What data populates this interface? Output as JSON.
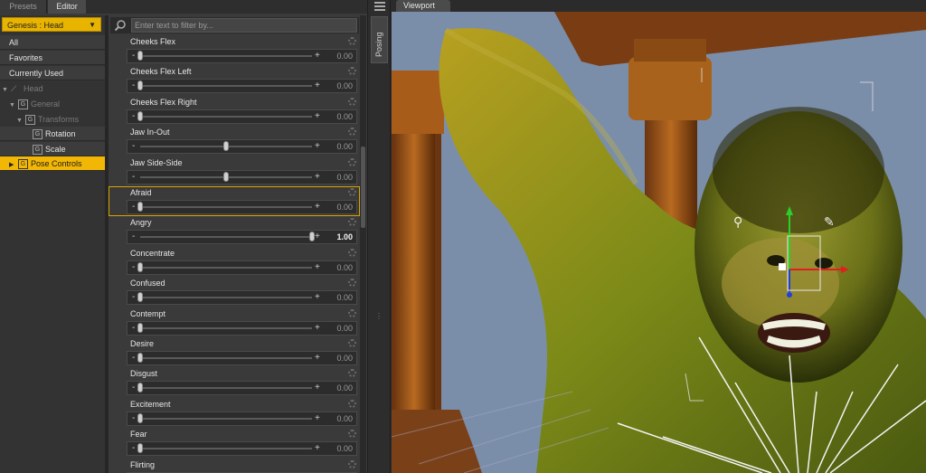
{
  "tabs": {
    "presets": "Presets",
    "editor": "Editor"
  },
  "node_selector": {
    "value": "Genesis : Head"
  },
  "tree": [
    {
      "label": "All"
    },
    {
      "label": "Favorites"
    },
    {
      "label": "Currently Used"
    },
    {
      "label": "Head"
    },
    {
      "label": "General"
    },
    {
      "label": "Transforms"
    },
    {
      "label": "Rotation"
    },
    {
      "label": "Scale"
    },
    {
      "label": "Pose Controls"
    }
  ],
  "filter": {
    "placeholder": "Enter text to filter by..."
  },
  "properties": [
    {
      "name": "Cheeks Flex",
      "value": "0.00",
      "level": 0
    },
    {
      "name": "Cheeks Flex Left",
      "value": "0.00",
      "level": 0
    },
    {
      "name": "Cheeks Flex Right",
      "value": "0.00",
      "level": 0
    },
    {
      "name": "Jaw In-Out",
      "value": "0.00",
      "level": 0.5
    },
    {
      "name": "Jaw Side-Side",
      "value": "0.00",
      "level": 0.5
    },
    {
      "name": "Afraid",
      "value": "0.00",
      "level": 0
    },
    {
      "name": "Angry",
      "value": "1.00",
      "level": 1
    },
    {
      "name": "Concentrate",
      "value": "0.00",
      "level": 0
    },
    {
      "name": "Confused",
      "value": "0.00",
      "level": 0
    },
    {
      "name": "Contempt",
      "value": "0.00",
      "level": 0
    },
    {
      "name": "Desire",
      "value": "0.00",
      "level": 0
    },
    {
      "name": "Disgust",
      "value": "0.00",
      "level": 0
    },
    {
      "name": "Excitement",
      "value": "0.00",
      "level": 0
    },
    {
      "name": "Fear",
      "value": "0.00",
      "level": 0
    },
    {
      "name": "Flirting",
      "value": "",
      "level": 0
    }
  ],
  "posing_tab": "Posing",
  "viewport": {
    "tab": "Viewport"
  },
  "colors": {
    "accent": "#f2b705",
    "panel": "#3a3a3a",
    "sky": "#7a8ca8"
  },
  "icons": [
    "search-icon",
    "menu-icon",
    "gear-icon",
    "bone-icon",
    "group-icon",
    "transform-gizmo-icon"
  ]
}
